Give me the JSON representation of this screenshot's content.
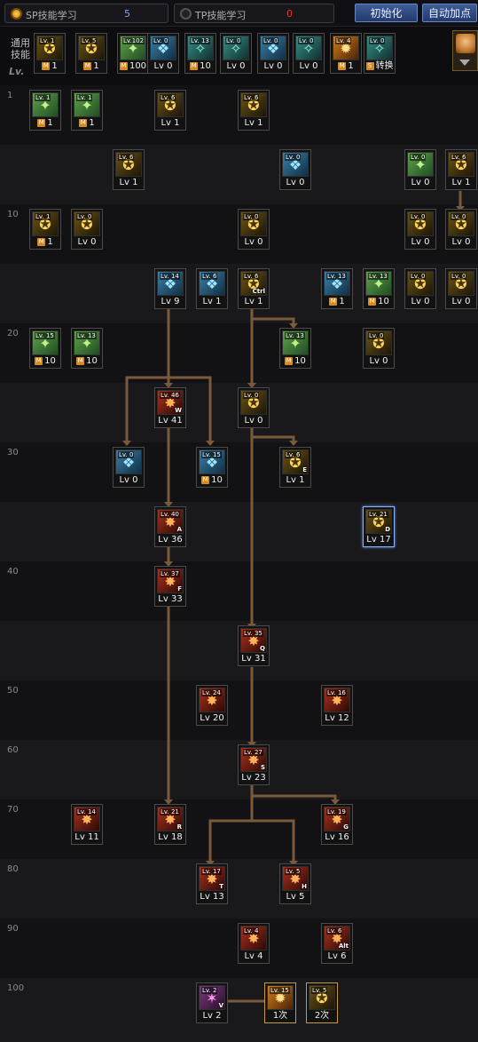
{
  "header": {
    "sp_label": "SP技能学习",
    "sp_value": "5",
    "tp_label": "TP技能学习",
    "tp_value": "0",
    "reset_button": "初始化",
    "auto_button": "自动加点"
  },
  "common_label": "通用\n技能",
  "lv_label": "Lv.",
  "colors": {
    "sp_dot": "#e8a21c",
    "sp_value": "#6fa8ff",
    "tp_value": "#e33a2a",
    "arrow": "#7a5a3a"
  },
  "levels": [
    "1",
    "10",
    "20",
    "30",
    "40",
    "50",
    "60",
    "70",
    "80",
    "90",
    "100"
  ],
  "common_skills": [
    {
      "badge": "Lv. 1",
      "lv": "1",
      "m": "M",
      "icon": "kick-icon",
      "tone": "gold"
    },
    {
      "badge": "Lv. 5",
      "lv": "1",
      "m": "M",
      "icon": "rush-icon",
      "tone": "gold"
    },
    {
      "badge": "Lv.102",
      "lv": "100",
      "m": "M",
      "icon": "dash-icon",
      "tone": "green"
    },
    {
      "badge": "Lv. 0",
      "lv": "Lv 0",
      "m": "",
      "icon": "wings-icon",
      "tone": "blue"
    },
    {
      "badge": "Lv. 13",
      "lv": "10",
      "m": "M",
      "icon": "leap-icon",
      "tone": "teal"
    },
    {
      "badge": "Lv. 0",
      "lv": "Lv 0",
      "m": "",
      "icon": "figure-icon",
      "tone": "teal"
    },
    {
      "badge": "Lv. 0",
      "lv": "Lv 0",
      "m": "",
      "icon": "eye-icon",
      "tone": "blue"
    },
    {
      "badge": "Lv. 0",
      "lv": "Lv 0",
      "m": "",
      "icon": "armor-icon",
      "tone": "teal"
    },
    {
      "badge": "Lv. 4",
      "lv": "1",
      "m": "M",
      "icon": "burst-icon",
      "tone": "orange"
    },
    {
      "badge": "Lv. 0",
      "lv": "转换",
      "m": "S",
      "icon": "magic-switch-icon",
      "tone": "teal"
    }
  ],
  "skills": [
    {
      "badge": "Lv. 1",
      "lv": "1",
      "m": "M",
      "icon": "claw-icon",
      "tone": "green",
      "key": ""
    },
    {
      "badge": "Lv. 1",
      "lv": "1",
      "m": "M",
      "icon": "guard-icon",
      "tone": "green",
      "key": ""
    },
    {
      "badge": "Lv. 6",
      "lv": "Lv 1",
      "m": "",
      "icon": "uppercut-icon",
      "tone": "gold",
      "key": ""
    },
    {
      "badge": "Lv. 6",
      "lv": "Lv 1",
      "m": "",
      "icon": "flip-icon",
      "tone": "gold",
      "key": ""
    },
    {
      "badge": "Lv. 6",
      "lv": "Lv 1",
      "m": "",
      "icon": "spark-icon",
      "tone": "gold",
      "key": ""
    },
    {
      "badge": "Lv. 0",
      "lv": "Lv 0",
      "m": "",
      "icon": "gun-icon",
      "tone": "blue",
      "key": ""
    },
    {
      "badge": "Lv. 0",
      "lv": "Lv 0",
      "m": "",
      "icon": "green-kick-icon",
      "tone": "green",
      "key": ""
    },
    {
      "badge": "Lv. 6",
      "lv": "Lv 1",
      "m": "",
      "icon": "speed-icon",
      "tone": "gold",
      "key": ""
    },
    {
      "badge": "Lv. 1",
      "lv": "1",
      "m": "M",
      "icon": "block-icon",
      "tone": "gold",
      "key": ""
    },
    {
      "badge": "Lv. 0",
      "lv": "Lv 0",
      "m": "",
      "icon": "explosion-icon",
      "tone": "gold",
      "key": ""
    },
    {
      "badge": "Lv. 0",
      "lv": "Lv 0",
      "m": "",
      "icon": "sparks-icon",
      "tone": "gold",
      "key": ""
    },
    {
      "badge": "Lv. 0",
      "lv": "Lv 0",
      "m": "",
      "icon": "slash-icon",
      "tone": "gold",
      "key": ""
    },
    {
      "badge": "Lv. 0",
      "lv": "Lv 0",
      "m": "",
      "icon": "dark-wave-icon",
      "tone": "gold",
      "key": ""
    },
    {
      "badge": "Lv. 14",
      "lv": "Lv 9",
      "m": "",
      "icon": "cannon-icon",
      "tone": "blue",
      "key": ""
    },
    {
      "badge": "Lv. 6",
      "lv": "Lv 1",
      "m": "",
      "icon": "laser-gun-icon",
      "tone": "blue",
      "key": ""
    },
    {
      "badge": "Lv. 6",
      "lv": "Lv 1",
      "m": "",
      "icon": "grenade-icon",
      "tone": "gold",
      "key": "Ctrl"
    },
    {
      "badge": "Lv. 13",
      "lv": "1",
      "m": "M",
      "icon": "mastery-icon",
      "tone": "blue",
      "key": ""
    },
    {
      "badge": "Lv. 13",
      "lv": "10",
      "m": "M",
      "icon": "drill-icon",
      "tone": "green",
      "key": ""
    },
    {
      "badge": "Lv. 0",
      "lv": "Lv 0",
      "m": "",
      "icon": "spring-icon",
      "tone": "gold",
      "key": ""
    },
    {
      "badge": "Lv. 0",
      "lv": "Lv 0",
      "m": "",
      "icon": "quake-icon",
      "tone": "gold",
      "key": ""
    },
    {
      "badge": "Lv. 15",
      "lv": "10",
      "m": "M",
      "icon": "crossed-guns-icon",
      "tone": "green",
      "key": ""
    },
    {
      "badge": "Lv. 13",
      "lv": "10",
      "m": "M",
      "icon": "rifle-icon",
      "tone": "green",
      "key": ""
    },
    {
      "badge": "Lv. 13",
      "lv": "10",
      "m": "M",
      "icon": "green-bomb-icon",
      "tone": "green",
      "key": ""
    },
    {
      "badge": "Lv. 0",
      "lv": "Lv 0",
      "m": "",
      "icon": "door-icon",
      "tone": "gold",
      "key": ""
    },
    {
      "badge": "Lv. 46",
      "lv": "Lv 41",
      "m": "",
      "icon": "flame-shot-icon",
      "tone": "red",
      "key": "W"
    },
    {
      "badge": "Lv. 0",
      "lv": "Lv 0",
      "m": "",
      "icon": "bomb-icon",
      "tone": "gold",
      "key": ""
    },
    {
      "badge": "Lv. 0",
      "lv": "Lv 0",
      "m": "",
      "icon": "ice-gun-icon",
      "tone": "blue",
      "key": ""
    },
    {
      "badge": "Lv. 15",
      "lv": "10",
      "m": "M",
      "icon": "clock-gun-icon",
      "tone": "blue",
      "key": ""
    },
    {
      "badge": "Lv. 6",
      "lv": "Lv 1",
      "m": "",
      "icon": "fire-bomb-icon",
      "tone": "gold",
      "key": "E"
    },
    {
      "badge": "Lv. 40",
      "lv": "Lv 36",
      "m": "",
      "icon": "heavy-cannon-icon",
      "tone": "red",
      "key": "A"
    },
    {
      "badge": "Lv. 21",
      "lv": "Lv 17",
      "m": "",
      "icon": "chest-icon",
      "tone": "gold",
      "key": "D",
      "selected": true
    },
    {
      "badge": "Lv. 37",
      "lv": "Lv 33",
      "m": "",
      "icon": "fire-wall-icon",
      "tone": "red",
      "key": "F"
    },
    {
      "badge": "Lv. 35",
      "lv": "Lv 31",
      "m": "",
      "icon": "barrel-icon",
      "tone": "red",
      "key": "Q"
    },
    {
      "badge": "Lv. 24",
      "lv": "Lv 20",
      "m": "",
      "icon": "toxic-icon",
      "tone": "red",
      "key": ""
    },
    {
      "badge": "Lv. 16",
      "lv": "Lv 12",
      "m": "",
      "icon": "fire-ring-icon",
      "tone": "red",
      "key": ""
    },
    {
      "badge": "Lv. 27",
      "lv": "Lv 23",
      "m": "",
      "icon": "missile-icon",
      "tone": "red",
      "key": "S"
    },
    {
      "badge": "Lv. 14",
      "lv": "Lv 11",
      "m": "",
      "icon": "mech-icon",
      "tone": "red",
      "key": ""
    },
    {
      "badge": "Lv. 21",
      "lv": "Lv 18",
      "m": "",
      "icon": "fire-burst-icon",
      "tone": "red",
      "key": "R"
    },
    {
      "badge": "Lv. 19",
      "lv": "Lv 16",
      "m": "",
      "icon": "fire-vortex-icon",
      "tone": "red",
      "key": "G"
    },
    {
      "badge": "Lv. 17",
      "lv": "Lv 13",
      "m": "",
      "icon": "blast-icon",
      "tone": "red",
      "key": "T"
    },
    {
      "badge": "Lv. 5",
      "lv": "Lv 5",
      "m": "",
      "icon": "claw-fire-icon",
      "tone": "red",
      "key": "H"
    },
    {
      "badge": "Lv. 4",
      "lv": "Lv 4",
      "m": "",
      "icon": "bug-icon",
      "tone": "red",
      "key": ""
    },
    {
      "badge": "Lv. 6",
      "lv": "Lv 6",
      "m": "",
      "icon": "star-burst-icon",
      "tone": "red",
      "key": "Alt"
    },
    {
      "badge": "Lv. 2",
      "lv": "Lv 2",
      "m": "",
      "icon": "spear-icon",
      "tone": "purple",
      "key": "V"
    },
    {
      "badge": "Lv. 15",
      "lv": "1次",
      "m": "",
      "icon": "awakening-one-icon",
      "tone": "orange",
      "key": "",
      "gold": true
    },
    {
      "badge": "Lv. 5",
      "lv": "2次",
      "m": "",
      "icon": "awakening-two-icon",
      "tone": "gold",
      "key": "",
      "gold": true
    }
  ]
}
